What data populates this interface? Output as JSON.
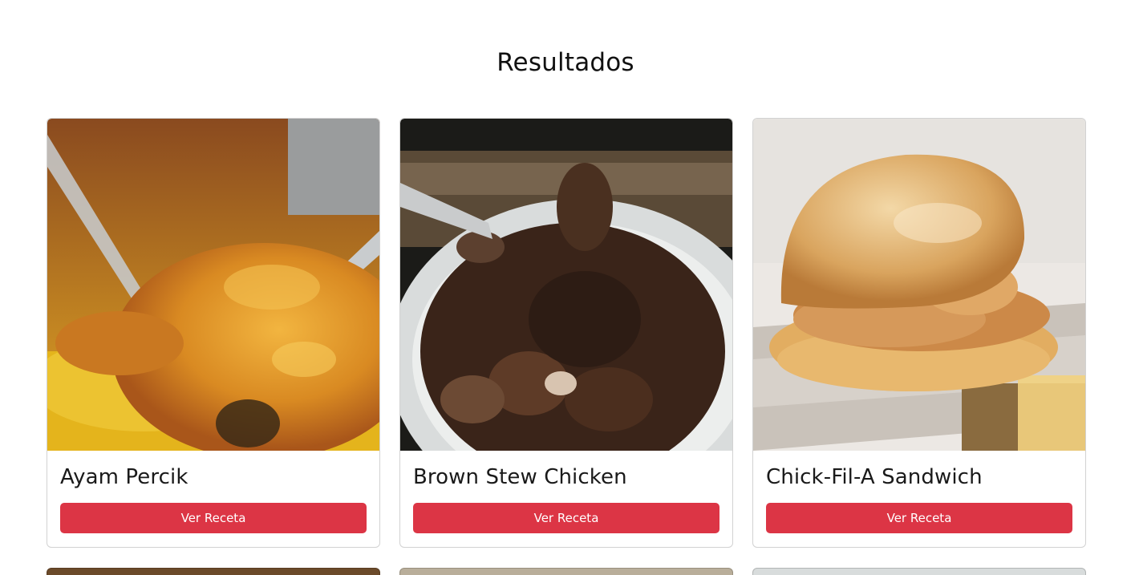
{
  "page": {
    "title": "Resultados"
  },
  "recipes": [
    {
      "name": "Ayam Percik",
      "button_label": "Ver Receta",
      "image_icon": "roasted-chicken-photo"
    },
    {
      "name": "Brown Stew Chicken",
      "button_label": "Ver Receta",
      "image_icon": "stew-bowl-photo"
    },
    {
      "name": "Chick-Fil-A Sandwich",
      "button_label": "Ver Receta",
      "image_icon": "chicken-sandwich-photo"
    }
  ],
  "colors": {
    "button": "#dc3545",
    "button_text": "#ffffff"
  }
}
